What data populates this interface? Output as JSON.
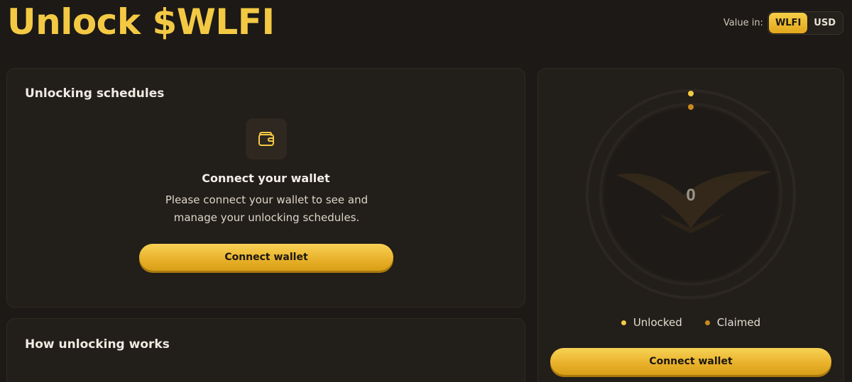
{
  "page": {
    "title": "Unlock $WLFI"
  },
  "value_toggle": {
    "label": "Value in:",
    "options": [
      "WLFI",
      "USD"
    ],
    "selected": "WLFI"
  },
  "schedules_card": {
    "heading": "Unlocking schedules",
    "icon": "wallet-icon",
    "empty_title": "Connect your wallet",
    "empty_desc_line1": "Please connect your wallet to see and",
    "empty_desc_line2": "manage your unlocking schedules.",
    "button_label": "Connect wallet"
  },
  "how_card": {
    "heading": "How unlocking works"
  },
  "chart_card": {
    "center_value": "0",
    "legend": [
      {
        "label": "Unlocked",
        "color": "#f3c944"
      },
      {
        "label": "Claimed",
        "color": "#c98a1c"
      }
    ],
    "button_label": "Connect wallet"
  },
  "colors": {
    "accent": "#f3c944",
    "background": "#1c1916",
    "card": "#221e1a"
  }
}
